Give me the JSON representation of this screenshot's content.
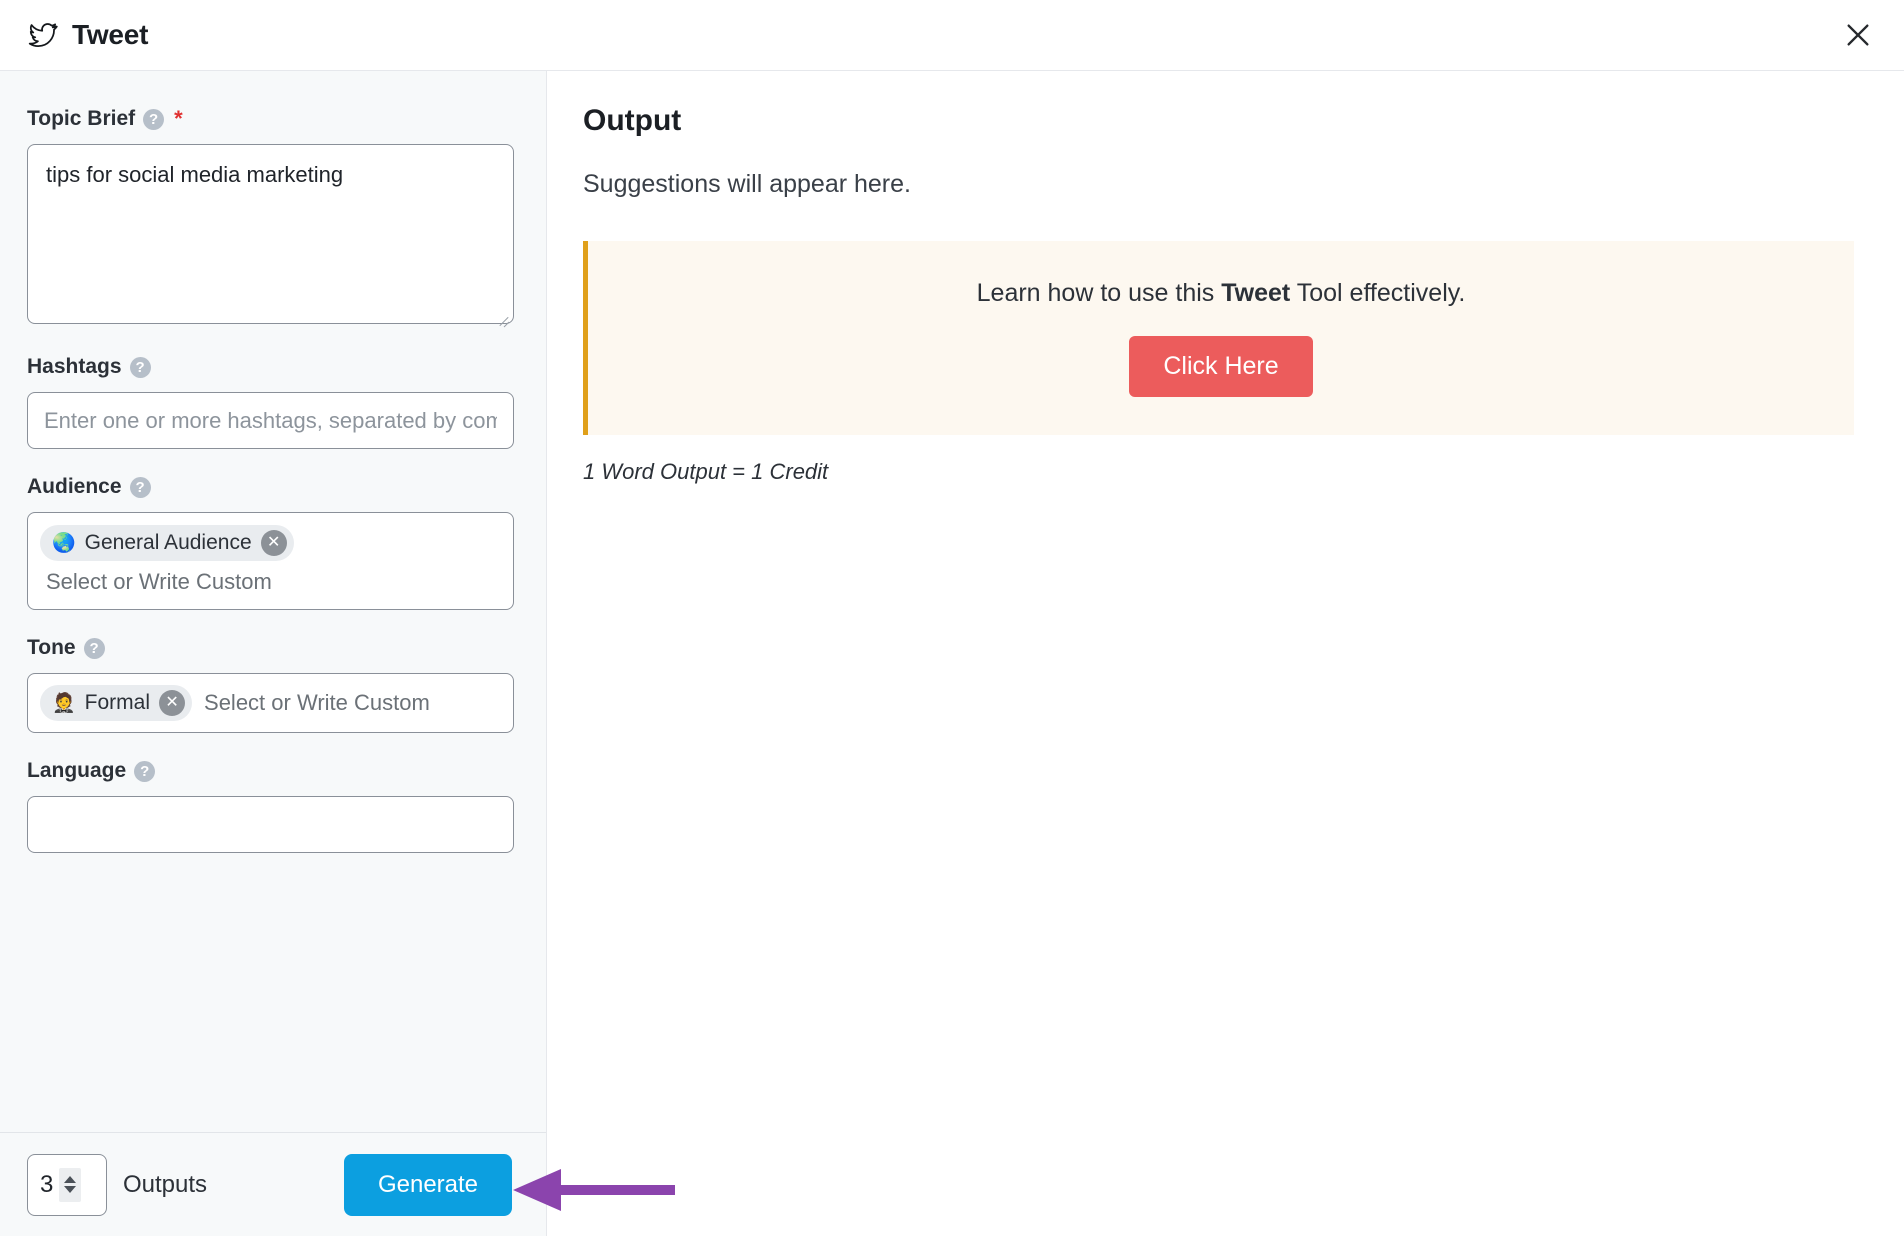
{
  "header": {
    "title": "Tweet",
    "icon": "twitter-bird-icon",
    "close_label": "×"
  },
  "form": {
    "fields": [
      {
        "key": "topic_brief",
        "label": "Topic Brief",
        "required": true,
        "required_marker": "*",
        "help": "?",
        "type": "textarea",
        "value": "tips for social media marketing",
        "placeholder": ""
      },
      {
        "key": "hashtags",
        "label": "Hashtags",
        "help": "?",
        "type": "input",
        "value": "",
        "placeholder": "Enter one or more hashtags, separated by commas"
      },
      {
        "key": "audience",
        "label": "Audience",
        "help": "?",
        "type": "multiselect",
        "placeholder": "Select or Write Custom",
        "chips": [
          {
            "emoji": "🌏",
            "label": "General Audience",
            "remove": "✕"
          }
        ]
      },
      {
        "key": "tone",
        "label": "Tone",
        "help": "?",
        "type": "multiselect",
        "placeholder": "Select or Write Custom",
        "chips": [
          {
            "emoji": "🤵",
            "label": "Formal",
            "remove": "✕"
          }
        ]
      },
      {
        "key": "language",
        "label": "Language",
        "help": "?",
        "type": "input",
        "value": "",
        "placeholder": ""
      }
    ]
  },
  "action_bar": {
    "outputs_count": "3",
    "outputs_label": "Outputs",
    "generate_label": "Generate"
  },
  "output": {
    "title": "Output",
    "subtitle": "Suggestions will appear here.",
    "banner": {
      "text_before": "Learn how to use this ",
      "text_bold": "Tweet",
      "text_after": " Tool effectively.",
      "button_label": "Click Here"
    },
    "credit_note": "1 Word Output = 1 Credit"
  },
  "annotation": {
    "arrow_color": "#8b44ad",
    "points_to": "generate-button"
  },
  "colors": {
    "generate_blue": "#0c9fe0",
    "click_here_red": "#ec5c5c",
    "banner_bg": "#fdf8f0",
    "banner_border": "#e0a01a",
    "panel_bg": "#f7f9fa",
    "required_red": "#e03131"
  }
}
